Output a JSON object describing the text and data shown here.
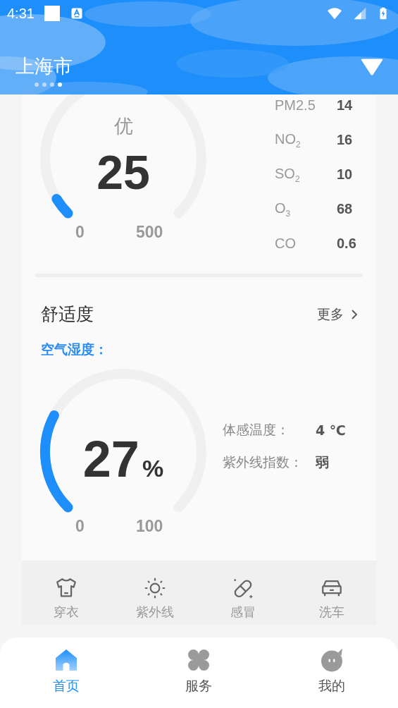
{
  "status_bar": {
    "time": "4:31"
  },
  "header": {
    "city": "上海市",
    "pages": [
      {
        "selected": false
      },
      {
        "selected": false
      },
      {
        "selected": false
      },
      {
        "selected": true
      }
    ]
  },
  "air_quality": {
    "grade": "优",
    "value": "25",
    "min": "0",
    "max": "500",
    "pollutants": [
      {
        "name": "PM2.5",
        "value": "14"
      },
      {
        "name": "NO$_{2}$",
        "value": "16"
      },
      {
        "name": "SO$_{2}$",
        "value": "10"
      },
      {
        "name": "O$_{3}$",
        "value": "68"
      },
      {
        "name": "CO",
        "value": "0.6"
      }
    ]
  },
  "comfort": {
    "title": "舒适度",
    "more": "更多",
    "humidity_label": "空气湿度：",
    "humidity": {
      "value": "27",
      "unit": "%",
      "min": "0",
      "max": "100"
    },
    "details": [
      {
        "label": "体感温度：",
        "value": "4 ℃"
      },
      {
        "label": "紫外线指数：",
        "value": "弱"
      }
    ]
  },
  "indices": [
    {
      "kind": "shirt",
      "label": "穿衣"
    },
    {
      "kind": "sun",
      "label": "紫外线"
    },
    {
      "kind": "pill",
      "label": "感冒"
    },
    {
      "kind": "car",
      "label": "洗车"
    }
  ],
  "bottom_nav": [
    {
      "kind": "home",
      "label": "首页",
      "selected": true
    },
    {
      "kind": "clover",
      "label": "服务",
      "selected": false
    },
    {
      "kind": "chat",
      "label": "我的",
      "selected": false
    }
  ]
}
